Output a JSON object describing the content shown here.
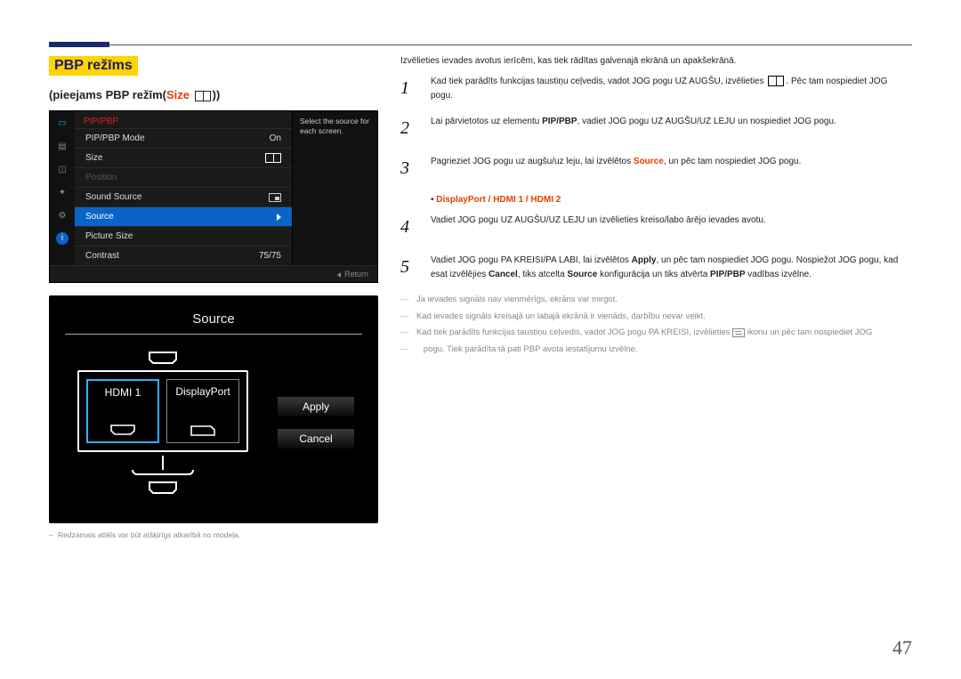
{
  "header": {
    "title": "PBP režīms"
  },
  "subhead": {
    "prefix": "pieejams PBP režīm",
    "size_label": "Size"
  },
  "osd": {
    "menu_title": "PIP/PBP",
    "hint": "Select the source for each screen.",
    "rows": {
      "mode_label": "PIP/PBP Mode",
      "mode_value": "On",
      "size_label": "Size",
      "position_label": "Position",
      "sound_label": "Sound Source",
      "source_label": "Source",
      "picsize_label": "Picture Size",
      "contrast_label": "Contrast",
      "contrast_value": "75/75",
      "return_label": "Return"
    }
  },
  "sourcepanel": {
    "title": "Source",
    "left_label": "HDMI 1",
    "right_label": "DisplayPort",
    "apply": "Apply",
    "cancel": "Cancel"
  },
  "left_footnote": "Redzamais attēls var būt atšķirīgs atkarībā no modeļa.",
  "right": {
    "intro": "Izvēlieties ievades avotus ierīcēm, kas tiek rādītas galvenajā ekrānā un apakšekrānā.",
    "step1_a": "Kad tiek parādīts funkcijas taustiņu ceļvedis, vadot JOG pogu UZ AUGŠU, izvēlieties ",
    "step1_b": ". Pēc tam nospiediet JOG pogu.",
    "step2_a": "Lai pārvietotos uz elementu ",
    "step2_k1": "PIP/PBP",
    "step2_b": ", vadiet JOG pogu UZ AUGŠU/UZ LEJU un nospiediet JOG pogu.",
    "step3_a": "Pagrieziet JOG pogu uz augšu/uz leju, lai izvēlētos ",
    "step3_k1": "Source",
    "step3_b": ", un pēc tam nospiediet JOG pogu.",
    "bullet_ports": "DisplayPort / HDMI 1 / HDMI 2",
    "step4": "Vadiet JOG pogu UZ AUGŠU/UZ LEJU un izvēlieties kreiso/labo ārējo ievades avotu.",
    "step5_a": "Vadiet JOG pogu PA KREISI/PA LABI, lai izvēlētos ",
    "step5_k1": "Apply",
    "step5_b": ", un pēc tam nospiediet JOG pogu. Nospiežot JOG pogu, kad esat izvēlējies ",
    "step5_k2": "Cancel",
    "step5_c": ", tiks atcelta ",
    "step5_k3": "Source",
    "step5_d": " konfigurācija un tiks atvērta ",
    "step5_k4": "PIP/PBP",
    "step5_e": " vadības izvēlne.",
    "note1": "Ja ievades signāls nav vienmērīgs, ekrāns var mirgot.",
    "note2": "Kad ievades signāls kreisajā un labajā ekrānā ir vienāds, darbību nevar veikt.",
    "note3_a": "Kad tiek parādīts funkcijas taustiņu ceļvedis, vadot JOG pogu PA KREISI, izvēlieties ",
    "note3_b": " ikonu un pēc tam nospiediet JOG",
    "note3_c": "pogu. Tiek parādīta tā pati PBP avota iestatījumu izvēlne."
  },
  "page_number": "47"
}
